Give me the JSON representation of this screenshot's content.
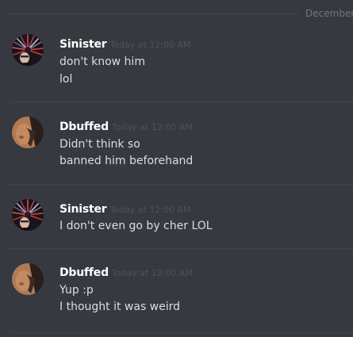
{
  "date_divider": "December",
  "messages": [
    {
      "author": "Sinister",
      "timestamp": "Today at 12:00 AM",
      "avatar_icon": "sinister-avatar-icon",
      "lines": [
        "don't know him",
        "lol"
      ]
    },
    {
      "author": "Dbuffed",
      "timestamp": "Today at 12:00 AM",
      "avatar_icon": "dbuffed-avatar-icon",
      "lines": [
        "Didn't think so",
        "banned him beforehand"
      ]
    },
    {
      "author": "Sinister",
      "timestamp": "Today at 12:00 AM",
      "avatar_icon": "sinister-avatar-icon",
      "lines": [
        "I don't even go by cher LOL"
      ]
    },
    {
      "author": "Dbuffed",
      "timestamp": "Today at 12:00 AM",
      "avatar_icon": "dbuffed-avatar-icon",
      "lines": [
        "Yup :p",
        "I thought it was weird"
      ]
    }
  ],
  "colors": {
    "background": "#36393f",
    "username": "#ffffff",
    "message_text": "#dcddde",
    "timestamp": "#4e5259",
    "divider_label": "#72767d"
  }
}
